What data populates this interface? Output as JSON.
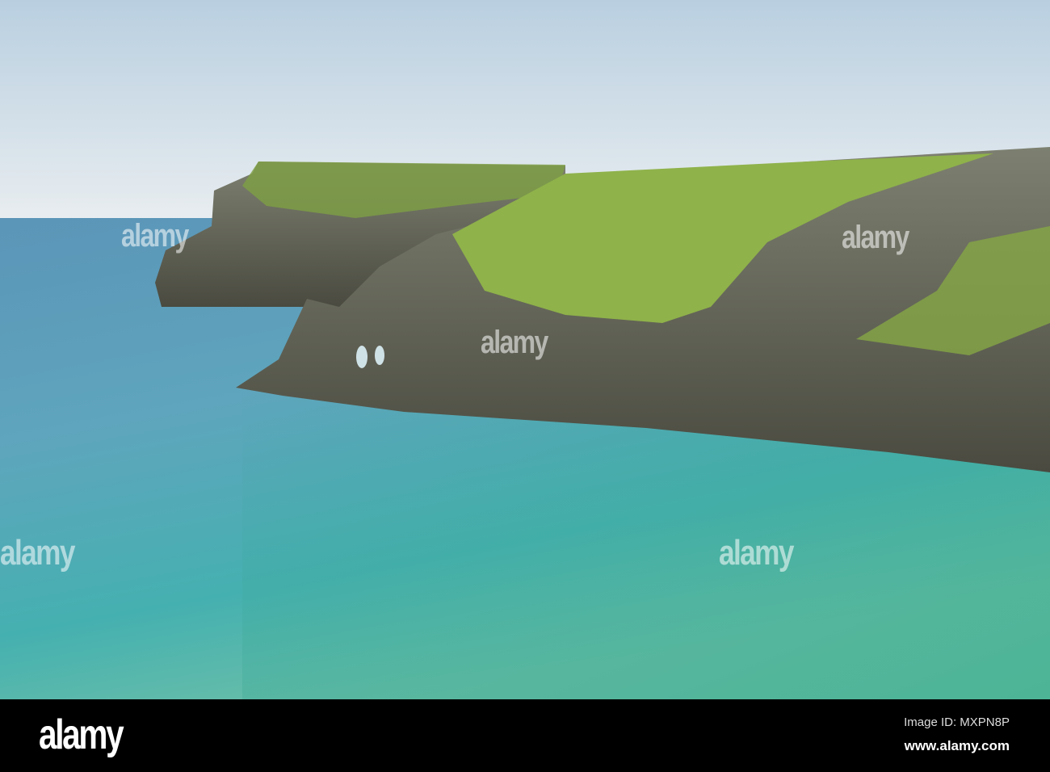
{
  "watermark": {
    "text": "alamy"
  },
  "footer": {
    "logo": "alamy",
    "image_id": "Image ID: MXPN8P",
    "website": "www.alamy.com"
  },
  "colors": {
    "sky": "#dde6ee",
    "sea_top": "#5f9fbf",
    "sea_bottom": "#4bb7a6",
    "grass": "#8fb24a",
    "rock": "#6f7266"
  }
}
